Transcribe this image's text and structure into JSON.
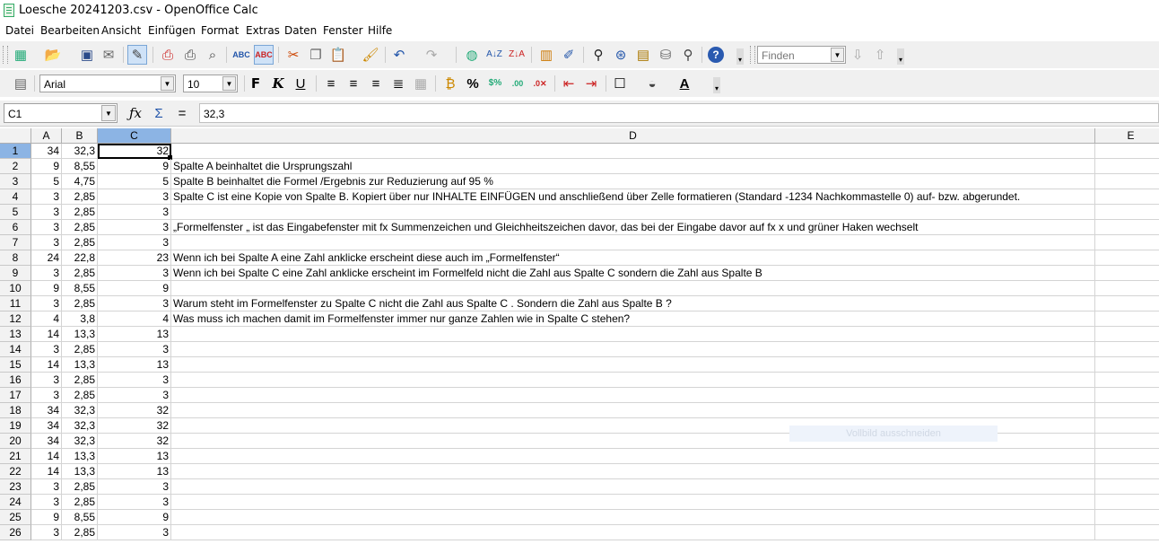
{
  "window": {
    "title": "Loesche 20241203.csv - OpenOffice Calc"
  },
  "menu": [
    "Datei",
    "Bearbeiten",
    "Ansicht",
    "Einfügen",
    "Format",
    "Extras",
    "Daten",
    "Fenster",
    "Hilfe"
  ],
  "toolbar": {
    "find_placeholder": "Finden"
  },
  "format_toolbar": {
    "font_name": "Arial",
    "font_size": "10"
  },
  "formula_bar": {
    "cell_ref": "C1",
    "content": "32,3"
  },
  "columns": [
    "A",
    "B",
    "C",
    "D",
    "E"
  ],
  "rows": [
    {
      "n": "1",
      "a": "34",
      "b": "32,3",
      "c": "32",
      "d": ""
    },
    {
      "n": "2",
      "a": "9",
      "b": "8,55",
      "c": "9",
      "d": "Spalte A beinhaltet die Ursprungszahl"
    },
    {
      "n": "3",
      "a": "5",
      "b": "4,75",
      "c": "5",
      "d": "Spalte B beinhaltet die Formel /Ergebnis zur Reduzierung auf 95 %"
    },
    {
      "n": "4",
      "a": "3",
      "b": "2,85",
      "c": "3",
      "d": "Spalte C ist eine Kopie von Spalte B. Kopiert über nur INHALTE EINFÜGEN und anschließend über Zelle formatieren (Standard -1234 Nachkommastelle 0) auf- bzw. abgerundet."
    },
    {
      "n": "5",
      "a": "3",
      "b": "2,85",
      "c": "3",
      "d": ""
    },
    {
      "n": "6",
      "a": "3",
      "b": "2,85",
      "c": "3",
      "d": "„Formelfenster „ ist das Eingabefenster mit fx Summenzeichen und Gleichheitszeichen davor,  das bei der Eingabe davor auf fx x und grüner Haken wechselt"
    },
    {
      "n": "7",
      "a": "3",
      "b": "2,85",
      "c": "3",
      "d": ""
    },
    {
      "n": "8",
      "a": "24",
      "b": "22,8",
      "c": "23",
      "d": "Wenn ich bei Spalte A eine Zahl anklicke erscheint diese auch im „Formelfenster“"
    },
    {
      "n": "9",
      "a": "3",
      "b": "2,85",
      "c": "3",
      "d": "Wenn ich bei Spalte C eine Zahl anklicke erscheint im Formelfeld nicht die Zahl aus Spalte C sondern die Zahl aus Spalte B"
    },
    {
      "n": "10",
      "a": "9",
      "b": "8,55",
      "c": "9",
      "d": ""
    },
    {
      "n": "11",
      "a": "3",
      "b": "2,85",
      "c": "3",
      "d": "Warum steht im Formelfenster zu Spalte C nicht die Zahl aus Spalte C . Sondern die Zahl aus Spalte B ?"
    },
    {
      "n": "12",
      "a": "4",
      "b": "3,8",
      "c": "4",
      "d": "Was muss ich machen damit im Formelfenster immer nur ganze Zahlen wie in Spalte C stehen?"
    },
    {
      "n": "13",
      "a": "14",
      "b": "13,3",
      "c": "13",
      "d": ""
    },
    {
      "n": "14",
      "a": "3",
      "b": "2,85",
      "c": "3",
      "d": ""
    },
    {
      "n": "15",
      "a": "14",
      "b": "13,3",
      "c": "13",
      "d": ""
    },
    {
      "n": "16",
      "a": "3",
      "b": "2,85",
      "c": "3",
      "d": ""
    },
    {
      "n": "17",
      "a": "3",
      "b": "2,85",
      "c": "3",
      "d": ""
    },
    {
      "n": "18",
      "a": "34",
      "b": "32,3",
      "c": "32",
      "d": ""
    },
    {
      "n": "19",
      "a": "34",
      "b": "32,3",
      "c": "32",
      "d": ""
    },
    {
      "n": "20",
      "a": "34",
      "b": "32,3",
      "c": "32",
      "d": ""
    },
    {
      "n": "21",
      "a": "14",
      "b": "13,3",
      "c": "13",
      "d": ""
    },
    {
      "n": "22",
      "a": "14",
      "b": "13,3",
      "c": "13",
      "d": ""
    },
    {
      "n": "23",
      "a": "3",
      "b": "2,85",
      "c": "3",
      "d": ""
    },
    {
      "n": "24",
      "a": "3",
      "b": "2,85",
      "c": "3",
      "d": ""
    },
    {
      "n": "25",
      "a": "9",
      "b": "8,55",
      "c": "9",
      "d": ""
    },
    {
      "n": "26",
      "a": "3",
      "b": "2,85",
      "c": "3",
      "d": ""
    }
  ],
  "overlay": {
    "ghost_text": "Vollbild ausschneiden"
  }
}
